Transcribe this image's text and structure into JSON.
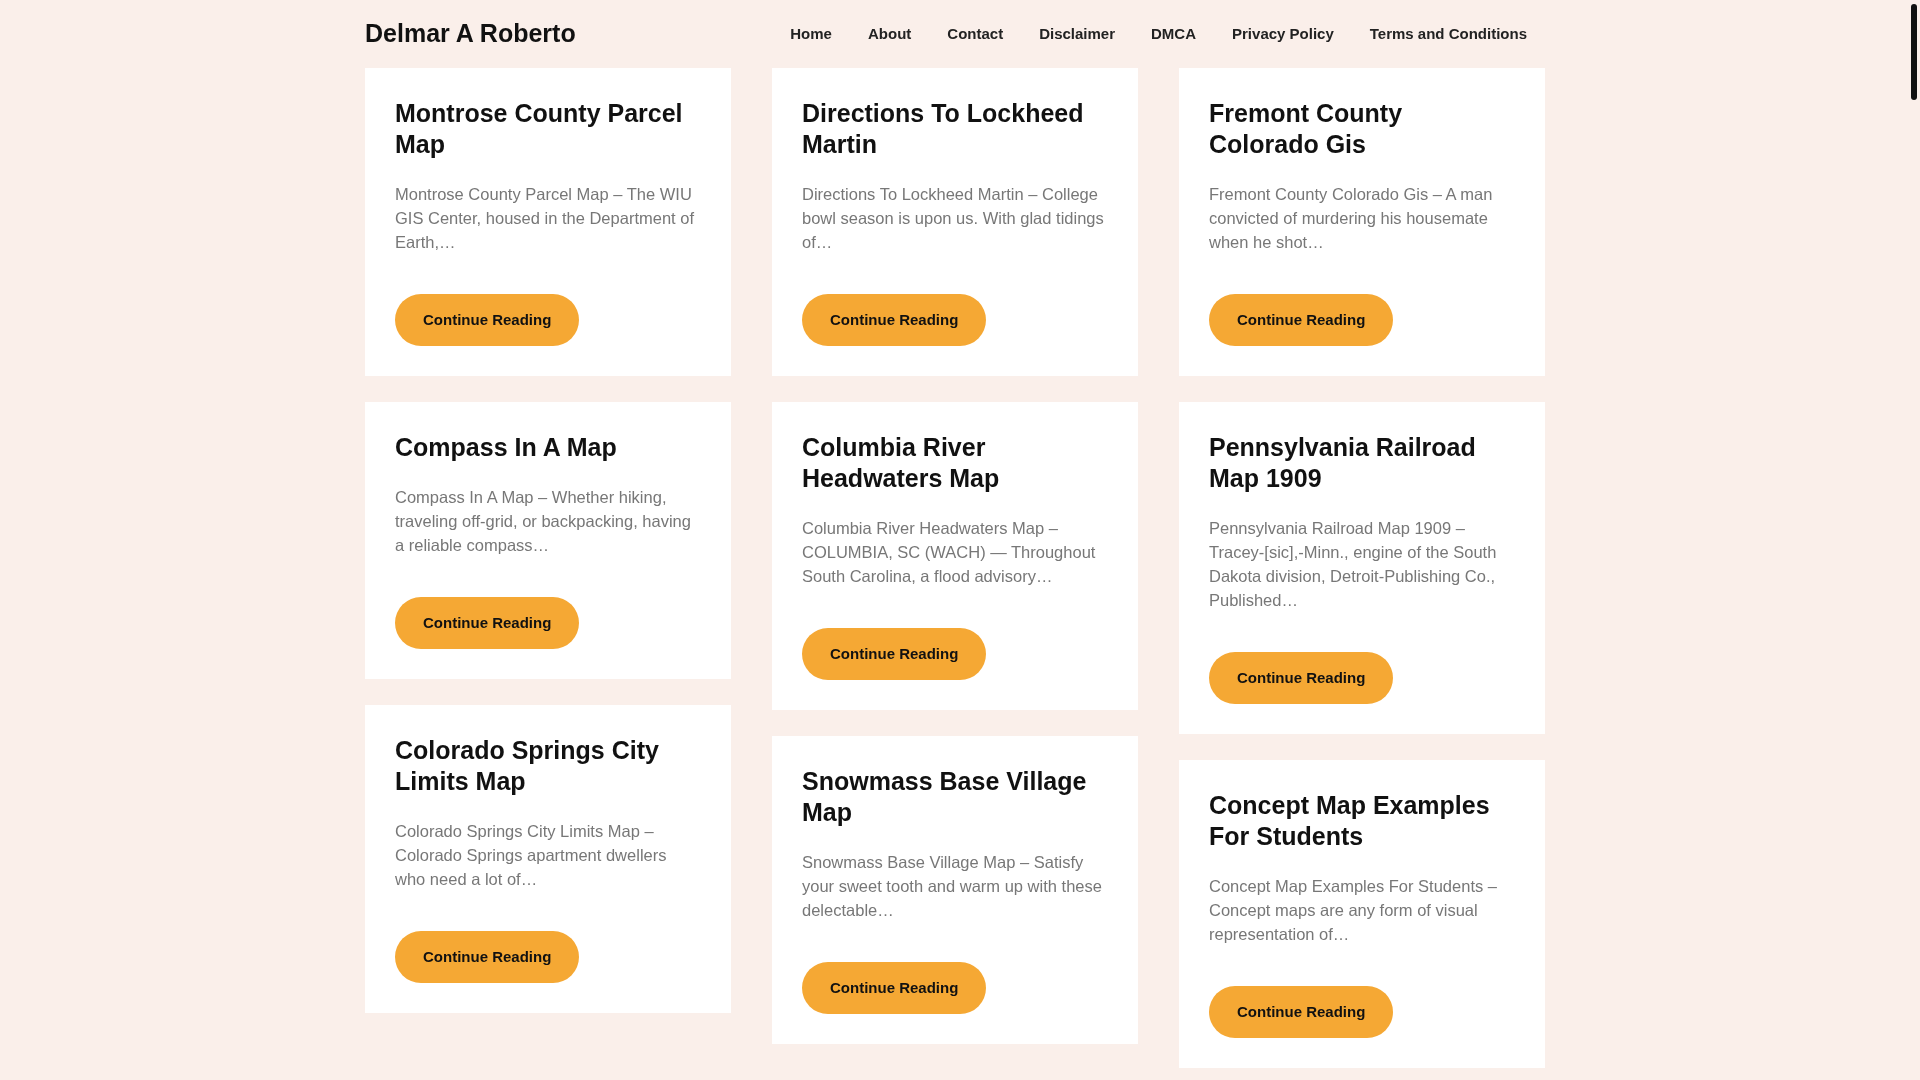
{
  "site_title": "Delmar A Roberto",
  "nav": [
    "Home",
    "About",
    "Contact",
    "Disclaimer",
    "DMCA",
    "Privacy Policy",
    "Terms and Conditions"
  ],
  "columns": [
    [
      {
        "title": "Montrose County Parcel Map",
        "excerpt": "Montrose County Parcel Map – The WIU GIS Center, housed in the Department of Earth,…",
        "button": "Continue Reading"
      },
      {
        "title": "Compass In A Map",
        "excerpt": "Compass In A Map – Whether hiking, traveling off-grid, or backpacking, having a reliable compass…",
        "button": "Continue Reading"
      },
      {
        "title": "Colorado Springs City Limits Map",
        "excerpt": "Colorado Springs City Limits Map – Colorado Springs apartment dwellers who need a lot of…",
        "button": "Continue Reading"
      }
    ],
    [
      {
        "title": "Directions To Lockheed Martin",
        "excerpt": "Directions To Lockheed Martin – College bowl season is upon us. With glad tidings of…",
        "button": "Continue Reading"
      },
      {
        "title": "Columbia River Headwaters Map",
        "excerpt": "Columbia River Headwaters Map – COLUMBIA, SC (WACH) — Throughout South Carolina, a flood advisory…",
        "button": "Continue Reading"
      },
      {
        "title": "Snowmass Base Village Map",
        "excerpt": "Snowmass Base Village Map – Satisfy your sweet tooth and warm up with these delectable…",
        "button": "Continue Reading"
      }
    ],
    [
      {
        "title": "Fremont County Colorado Gis",
        "excerpt": "Fremont County Colorado Gis – A man convicted of murdering his housemate when he shot…",
        "button": "Continue Reading"
      },
      {
        "title": "Pennsylvania Railroad Map 1909",
        "excerpt": "Pennsylvania Railroad Map 1909 – Tracey-[sic],-Minn., engine of the South Dakota division, Detroit-Publishing Co., Published…",
        "button": "Continue Reading"
      },
      {
        "title": "Concept Map Examples For Students",
        "excerpt": "Concept Map Examples For Students – Concept maps are any form of visual representation of…",
        "button": "Continue Reading"
      }
    ]
  ]
}
